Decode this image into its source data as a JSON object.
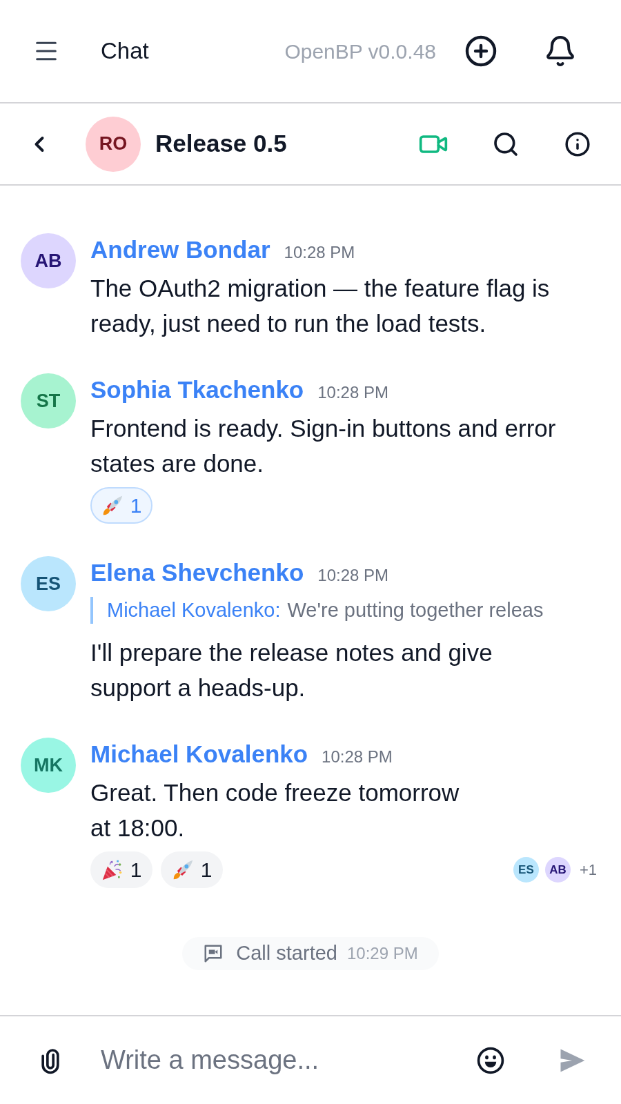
{
  "top_bar": {
    "title": "Chat",
    "version": "OpenBP v0.0.48"
  },
  "chat_header": {
    "avatar": {
      "initials": "RO",
      "color": "#fecdd3"
    },
    "title": "Release 0.5"
  },
  "messages": [
    {
      "author": "Andrew Bondar",
      "initials": "AB",
      "color": "#ddd6fe",
      "time": "10:28 PM",
      "text": "The OAuth2 migration — the feature flag is\nready, just need to run the load tests."
    },
    {
      "author": "Sophia Tkachenko",
      "initials": "ST",
      "color": "#a7f3d0",
      "time": "10:28 PM",
      "text": "Frontend is ready. Sign-in buttons and error\nstates are done.",
      "reactions": [
        {
          "kind": "rocket",
          "count": "1",
          "selected": true
        }
      ]
    },
    {
      "author": "Elena Shevchenko",
      "initials": "ES",
      "color": "#bae6fd",
      "time": "10:28 PM",
      "quote": {
        "author": "Michael Kovalenko:",
        "text": "We're putting together releas"
      },
      "text": "I'll prepare the release notes and give\nsupport a heads-up."
    },
    {
      "author": "Michael Kovalenko",
      "initials": "MK",
      "color": "#99f6e4",
      "time": "10:28 PM",
      "text": "Great. Then code freeze tomorrow\nat 18:00.",
      "reactions": [
        {
          "kind": "party",
          "count": "1",
          "selected": false
        },
        {
          "kind": "rocket",
          "count": "1",
          "selected": false
        }
      ],
      "read_by": [
        {
          "initials": "ES",
          "color": "#bae6fd"
        },
        {
          "initials": "AB",
          "color": "#ddd6fe"
        }
      ],
      "read_more": "+1"
    }
  ],
  "call_event": {
    "text": "Call started",
    "time": "10:29 PM"
  },
  "composer": {
    "placeholder": "Write a message...",
    "send_disabled": true
  }
}
